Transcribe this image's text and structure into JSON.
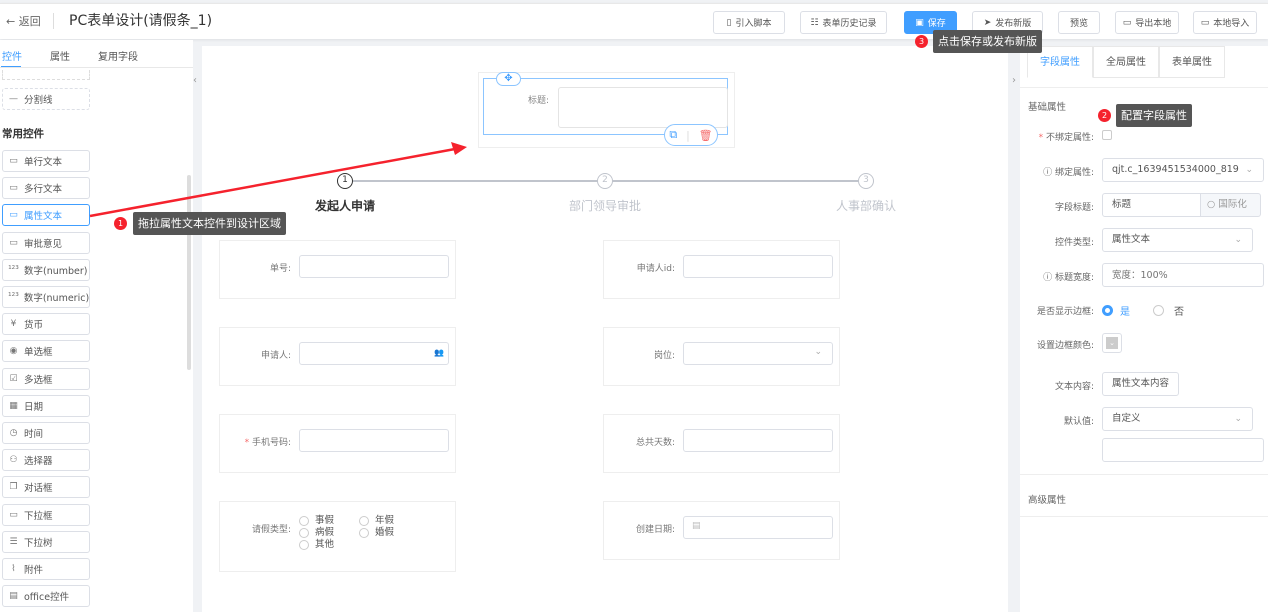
{
  "header": {
    "back": "返回",
    "title": "PC表单设计(请假条_1)",
    "buttons": [
      {
        "label": "引入脚本",
        "icon": "script-icon"
      },
      {
        "label": "表单历史记录",
        "icon": "list-icon"
      },
      {
        "label": "保存",
        "icon": "save-icon"
      },
      {
        "label": "发布新版",
        "icon": "send-icon"
      },
      {
        "label": "预览"
      },
      {
        "label": "导出本地",
        "icon": "folder-icon"
      },
      {
        "label": "本地导入",
        "icon": "folder-open-icon"
      }
    ]
  },
  "left": {
    "tabs": [
      "控件",
      "属性",
      "复用字段"
    ],
    "active_tab": "控件",
    "divider_item": "分割线",
    "section": "常用控件",
    "controls": [
      "单行文本",
      "多行文本",
      "属性文本",
      "审批意见",
      "数字(number)",
      "数字(numeric)",
      "货币",
      "单选框",
      "多选框",
      "日期",
      "时间",
      "选择器",
      "对话框",
      "下拉框",
      "下拉树",
      "附件",
      "office控件"
    ],
    "selected": "属性文本"
  },
  "canvas": {
    "selected_field_label": "标题:",
    "steps": [
      "发起人申请",
      "部门领导审批",
      "人事部确认"
    ],
    "step_numbers": [
      "1",
      "2",
      "3"
    ],
    "fields": {
      "order_no": "单号:",
      "applicant_id": "申请人id:",
      "applicant": "申请人:",
      "position": "岗位:",
      "phone": "手机号码:",
      "total_days": "总共天数:",
      "leave_type": "请假类型:",
      "create_date": "创建日期:"
    },
    "leave_options": [
      "事假",
      "年假",
      "病假",
      "婚假",
      "其他"
    ]
  },
  "annotations": {
    "a1": {
      "num": "1",
      "text": "拖拉属性文本控件到设计区域"
    },
    "a2": {
      "num": "2",
      "text": "配置字段属性"
    },
    "a3": {
      "num": "3",
      "text": "点击保存或发布新版"
    },
    "color": "#f5222d"
  },
  "right": {
    "tabs": [
      "字段属性",
      "全局属性",
      "表单属性"
    ],
    "active_tab": "字段属性",
    "section": "基础属性",
    "advanced": "高级属性",
    "rows": {
      "unbind": "不绑定属性:",
      "bind": "绑定属性:",
      "bind_value": "qjt.c_1639451534000_819",
      "field_title": "字段标题:",
      "field_title_value": "标题",
      "i18n": "国际化",
      "control_type": "控件类型:",
      "control_type_value": "属性文本",
      "title_width": "标题宽度:",
      "title_width_placeholder": "宽度：100%",
      "show_border": "是否显示边框:",
      "yes": "是",
      "no": "否",
      "border_color": "设置边框颜色:",
      "text_content": "文本内容:",
      "text_content_value": "属性文本内容",
      "default": "默认值:",
      "default_value": "自定义"
    }
  },
  "colors": {
    "accent": "#409eff",
    "danger": "#f56c6c"
  }
}
